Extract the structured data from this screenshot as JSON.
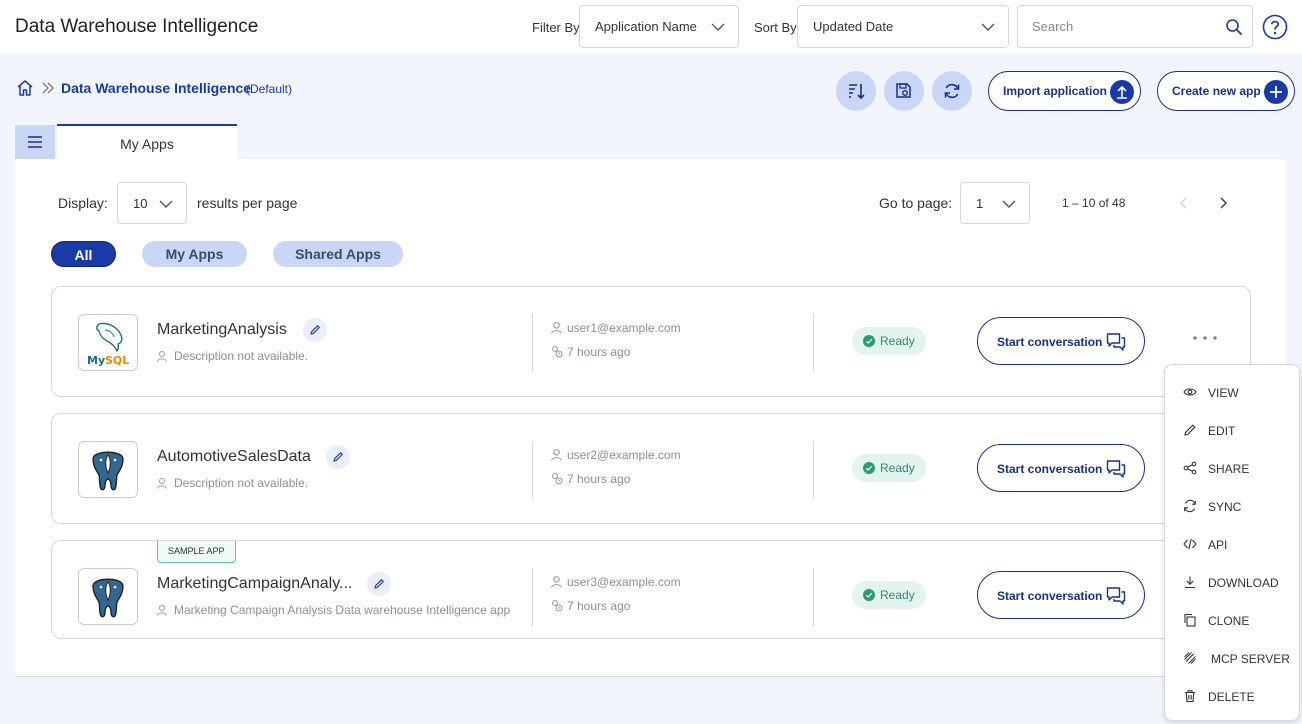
{
  "header": {
    "title": "Data Warehouse Intelligence",
    "filter_label": "Filter By",
    "filter_value": "Application Name",
    "sort_label": "Sort By",
    "sort_value": "Updated Date",
    "search_placeholder": "Search"
  },
  "breadcrumb": {
    "current": "Data Warehouse Intelligence",
    "suffix": "(Default)"
  },
  "actions": {
    "import_label": "Import application",
    "create_label": "Create new app"
  },
  "tabs": {
    "active": "My Apps"
  },
  "pagination": {
    "display_label": "Display:",
    "per_page": "10",
    "per_page_suffix": "results per page",
    "goto_label": "Go to page:",
    "page": "1",
    "range": "1 – 10 of 48"
  },
  "filters": [
    "All",
    "My Apps",
    "Shared Apps"
  ],
  "apps": [
    {
      "name": "MarketingAnalysis",
      "description": "Description not available.",
      "owner": "user1@example.com",
      "updated": "7 hours ago",
      "status": "Ready",
      "logo": "mysql-logo",
      "conversation_label": "Start conversation"
    },
    {
      "name": "AutomotiveSalesData",
      "description": "Description not available.",
      "owner": "user2@example.com",
      "updated": "7 hours ago",
      "status": "Ready",
      "logo": "postgresql-logo",
      "conversation_label": "Start conversation"
    },
    {
      "name": "MarketingCampaignAnaly...",
      "badge": "SAMPLE APP",
      "description": "Marketing Campaign Analysis Data warehouse Intelligence app",
      "owner": "user3@example.com",
      "updated": "7 hours ago",
      "status": "Ready",
      "logo": "postgresql-logo",
      "conversation_label": "Start conversation"
    }
  ],
  "context_menu": [
    "VIEW",
    "EDIT",
    "SHARE",
    "SYNC",
    "API",
    "DOWNLOAD",
    "CLONE",
    "MCP SERVER",
    "DELETE"
  ],
  "colors": {
    "accent": "#1a3aa8",
    "chip_bg": "#c9d6f6",
    "ready_bg": "#e3f4ef",
    "ready_text": "#2c8a6e"
  }
}
